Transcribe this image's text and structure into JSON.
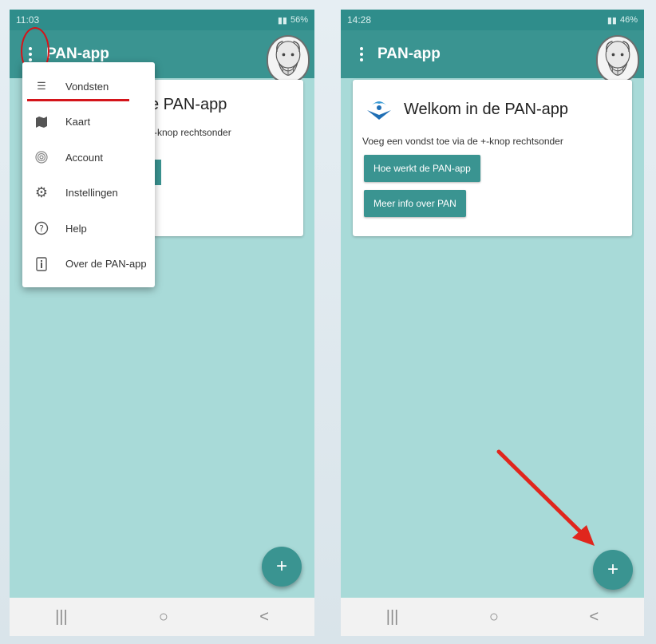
{
  "left": {
    "status_time": "11:03",
    "status_battery": "56%",
    "app_title": "PAN-app",
    "card_title_partial": "e PAN-app",
    "card_text_partial": "+-knop rechtsonder",
    "menu": [
      {
        "label": "Vondsten",
        "icon": "list-icon"
      },
      {
        "label": "Kaart",
        "icon": "map-icon"
      },
      {
        "label": "Account",
        "icon": "fingerprint-icon"
      },
      {
        "label": "Instellingen",
        "icon": "gear-icon"
      },
      {
        "label": "Help",
        "icon": "help-icon"
      },
      {
        "label": "Over de PAN-app",
        "icon": "info-icon"
      }
    ],
    "fab_label": "+"
  },
  "right": {
    "status_time": "14:28",
    "status_battery": "46%",
    "app_title": "PAN-app",
    "card_title": "Welkom in de PAN-app",
    "card_text": "Voeg een vondst toe via de +-knop rechtsonder",
    "button_how": "Hoe werkt de PAN-app",
    "button_info": "Meer info over PAN",
    "fab_label": "+"
  },
  "navbar": {
    "recent": "|||",
    "home": "○",
    "back": "<"
  },
  "colors": {
    "primary": "#3a9491",
    "background": "#a8dad8",
    "accent_red": "#d4141a"
  }
}
